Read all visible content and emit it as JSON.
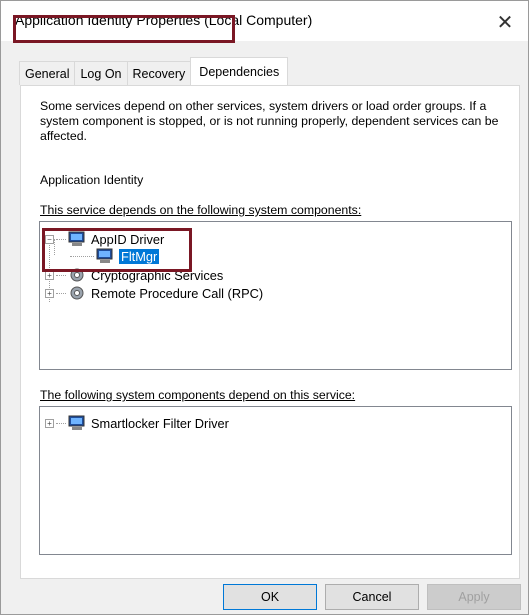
{
  "window": {
    "title": "Application Identity Properties (Local Computer)",
    "close_label": "✕"
  },
  "tabs": [
    {
      "label": "General",
      "active": false
    },
    {
      "label": "Log On",
      "active": false
    },
    {
      "label": "Recovery",
      "active": false
    },
    {
      "label": "Dependencies",
      "active": true
    }
  ],
  "dependencies": {
    "description": "Some services depend on other services, system drivers or load order groups. If a system component is stopped, or is not running properly, dependent services can be affected.",
    "service_name": "Application Identity",
    "depends_on_label": "This service depends on the following system components:",
    "depends_on_tree": [
      {
        "label": "AppID Driver",
        "icon": "computer-icon",
        "expanded": true,
        "children": [
          {
            "label": "FltMgr",
            "icon": "computer-icon",
            "selected": true
          }
        ]
      },
      {
        "label": "Cryptographic Services",
        "icon": "gear-icon",
        "expanded": false
      },
      {
        "label": "Remote Procedure Call (RPC)",
        "icon": "gear-icon",
        "expanded": false
      }
    ],
    "dependents_label": "The following system components depend on this service:",
    "dependents_tree": [
      {
        "label": "Smartlocker Filter Driver",
        "icon": "computer-icon",
        "expanded": false
      }
    ]
  },
  "buttons": {
    "ok": "OK",
    "cancel": "Cancel",
    "apply": "Apply"
  },
  "colors": {
    "highlight_box": "#7a1724",
    "selection": "#0078d7"
  }
}
